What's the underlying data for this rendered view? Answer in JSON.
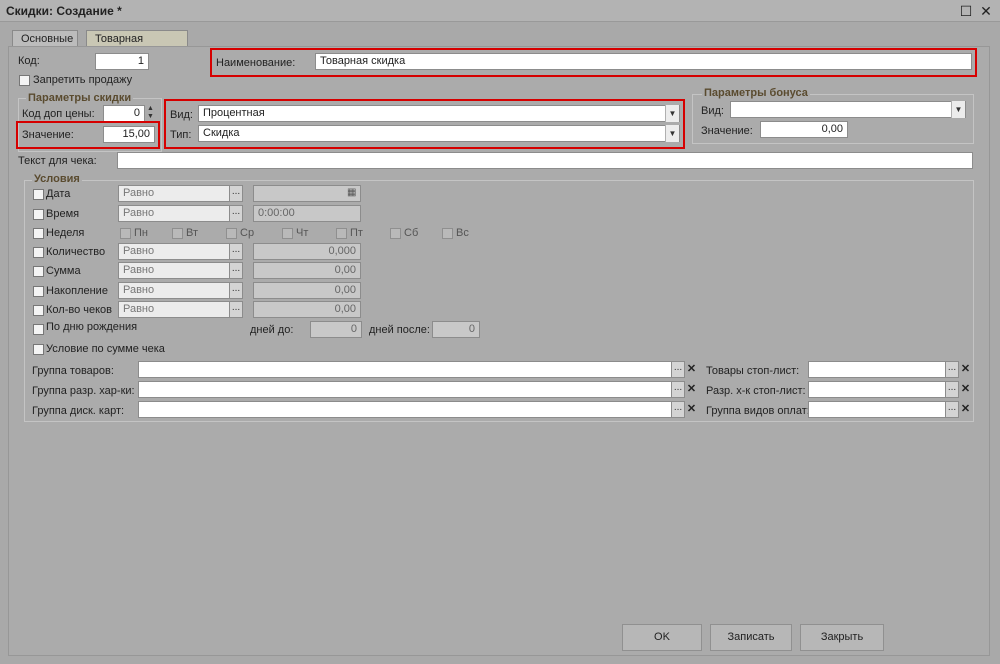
{
  "window": {
    "title": "Скидки: Создание *",
    "maximize_icon": "maximize-icon",
    "close_icon": "close-icon"
  },
  "tabs": [
    {
      "label": "Основные",
      "active": true
    },
    {
      "label": "Товарная скидка",
      "active": false
    }
  ],
  "main": {
    "code_label": "Код:",
    "code_value": "1",
    "forbid_sale_label": "Запретить продажу",
    "name_label": "Наименование:",
    "name_value": "Товарная скидка",
    "discount_params": {
      "title": "Параметры скидки",
      "price_code_label": "Код доп цены:",
      "price_code_value": "0",
      "value_label": "Значение:",
      "value_value": "15,00",
      "kind_label": "Вид:",
      "kind_value": "Процентная",
      "type_label": "Тип:",
      "type_value": "Скидка"
    },
    "bonus_params": {
      "title": "Параметры бонуса",
      "kind_label": "Вид:",
      "kind_value": "",
      "value_label": "Значение:",
      "value_value": "0,00"
    },
    "receipt_text_label": "Текст для чека:",
    "receipt_text_value": ""
  },
  "conditions": {
    "title": "Условия",
    "rows": [
      {
        "label": "Дата",
        "op": "Равно",
        "value": ""
      },
      {
        "label": "Время",
        "op": "Равно",
        "value": "0:00:00"
      },
      {
        "label": "Количество",
        "op": "Равно",
        "value": "0,000"
      },
      {
        "label": "Сумма",
        "op": "Равно",
        "value": "0,00"
      },
      {
        "label": "Накопление",
        "op": "Равно",
        "value": "0,00"
      },
      {
        "label": "Кол-во чеков",
        "op": "Равно",
        "value": "0,00"
      }
    ],
    "week_label": "Неделя",
    "days": [
      "Пн",
      "Вт",
      "Ср",
      "Чт",
      "Пт",
      "Сб",
      "Вс"
    ],
    "birthday_label": "По дню рождения",
    "days_before_label": "дней до:",
    "days_before_value": "0",
    "days_after_label": "дней после:",
    "days_after_value": "0",
    "receipt_sum_label": "Условие по сумме чека",
    "groups_left": [
      {
        "label": "Группа товаров:",
        "value": ""
      },
      {
        "label": "Группа разр. хар-ки:",
        "value": ""
      },
      {
        "label": "Группа диск. карт:",
        "value": ""
      }
    ],
    "groups_right": [
      {
        "label": "Товары стоп-лист:",
        "value": ""
      },
      {
        "label": "Разр. х-к стоп-лист:",
        "value": ""
      },
      {
        "label": "Группа видов оплат:",
        "value": ""
      }
    ]
  },
  "buttons": {
    "ok": "OK",
    "save": "Записать",
    "close": "Закрыть"
  },
  "highlight_color": "#d60000"
}
